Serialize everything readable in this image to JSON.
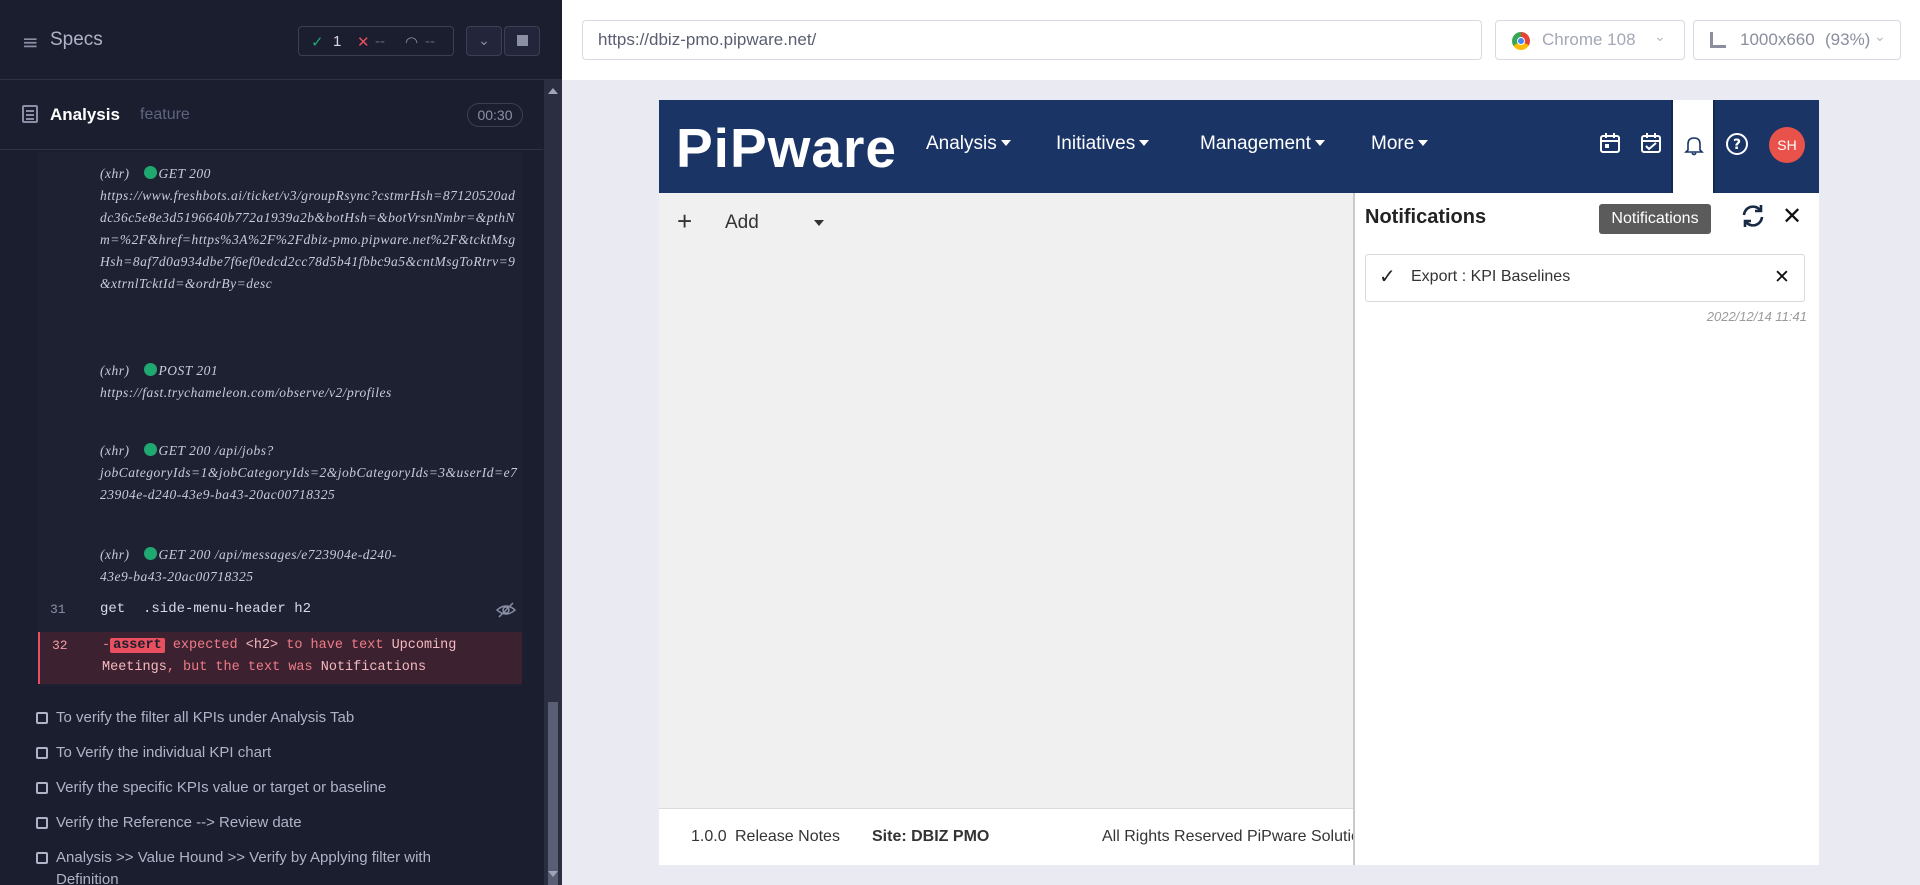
{
  "runner": {
    "specs_label": "Specs",
    "stats": {
      "passed": "1",
      "failed": "--",
      "pending": "--"
    },
    "spec": {
      "name": "Analysis",
      "type": "feature",
      "duration": "00:30"
    },
    "log": [
      {
        "kind": "(xhr)",
        "method": "GET 200",
        "line1": "",
        "body": "https://www.freshbots.ai/ticket/v3/groupRsync?cstmrHsh=87120520addc36c5e8e3d5196640b772a1939a2b&botHsh=&botVrsnNmbr=&pthNm=%2F&href=https%3A%2F%2Fdbiz-pmo.pipware.net%2F&tcktMsgHsh=8af7d0a934dbe7f6ef0edcd2cc78d5b41fbbc9a5&cntMsgToRtrv=9&xtrnlTcktId=&ordrBy=desc"
      },
      {
        "kind": "(xhr)",
        "method": "POST 201",
        "body": "https://fast.trychameleon.com/observe/v2/profiles"
      },
      {
        "kind": "(xhr)",
        "method": "GET 200",
        "inline": "/api/jobs?",
        "body": "jobCategoryIds=1&jobCategoryIds=2&jobCategoryIds=3&userId=e723904e-d240-43e9-ba43-20ac00718325"
      },
      {
        "kind": "(xhr)",
        "method": "GET 200",
        "inline": "/api/messages/e723904e-d240-",
        "body": "43e9-ba43-20ac00718325"
      }
    ],
    "cmd31": {
      "num": "31",
      "name": "get",
      "arg": ".side-menu-header h2"
    },
    "cmd32": {
      "num": "32",
      "prefix": "-",
      "badge": "assert",
      "text1": " expected ",
      "tag": "<h2>",
      "text2": " to have text ",
      "val1": "Upcoming",
      "line2_val": "Meetings",
      "text3": ", but the text was ",
      "val2": "Notifications"
    },
    "tests": [
      "To verify the filter all KPIs under Analysis Tab",
      "To Verify the individual KPI chart",
      "Verify the specific KPIs value or target or baseline",
      "Verify the Reference --> Review date",
      "Analysis >> Value Hound >> Verify by Applying filter with Definition"
    ]
  },
  "browser_bar": {
    "url": "https://dbiz-pmo.pipware.net/",
    "browser": "Chrome 108",
    "viewport": "1000x660",
    "zoom": "(93%)"
  },
  "app": {
    "logo": "PiPware",
    "menu": [
      "Analysis",
      "Initiatives",
      "Management",
      "More"
    ],
    "avatar_initials": "SH",
    "add_label": "Add",
    "footer": {
      "version": "1.0.0",
      "release_notes": "Release Notes",
      "site": "Site: DBIZ PMO",
      "rights": "All Rights Reserved PiPware Solutic"
    },
    "notifications": {
      "title": "Notifications",
      "tooltip": "Notifications",
      "items": [
        {
          "label": "Export : KPI Baselines",
          "date": "2022/12/14 11:41"
        }
      ]
    }
  },
  "colors": {
    "nav_bg": "#1a3466",
    "runner_bg": "#1b1e2e",
    "pass": "#1fa971",
    "fail": "#e94f5f",
    "avatar": "#e8524a"
  }
}
